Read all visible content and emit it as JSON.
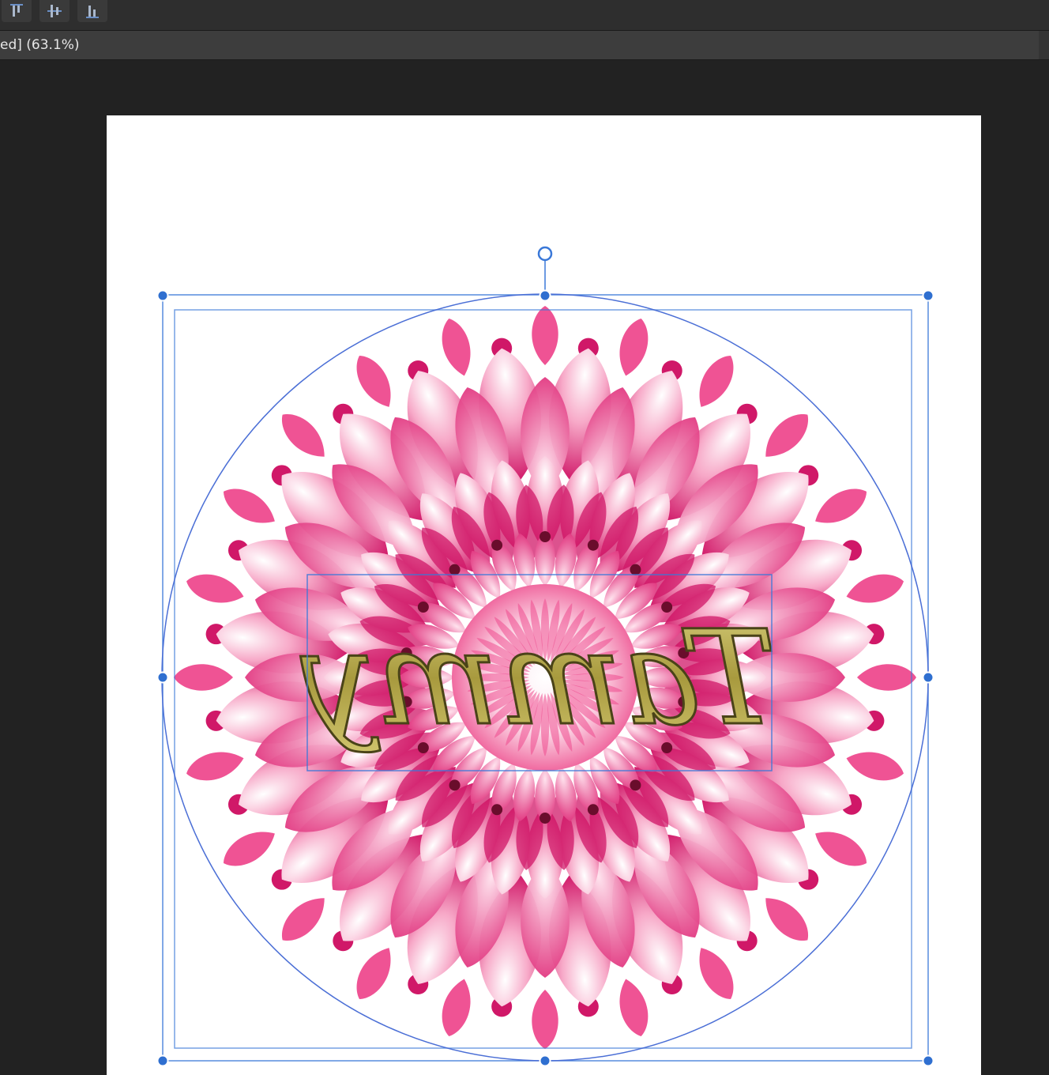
{
  "toolbar": {
    "buttons": [
      {
        "name": "align-top-icon"
      },
      {
        "name": "align-middle-icon"
      },
      {
        "name": "align-bottom-icon"
      }
    ]
  },
  "document": {
    "tab_title": "ed] (63.1%)"
  },
  "canvas": {
    "text_layer": "Tammy",
    "colors": {
      "selection": "#3a78d8",
      "mandala_dark": "#d01868",
      "mandala_mid": "#ee4a8e",
      "mandala_light": "#f9c6da",
      "text_gold": "#b8ad55"
    }
  }
}
